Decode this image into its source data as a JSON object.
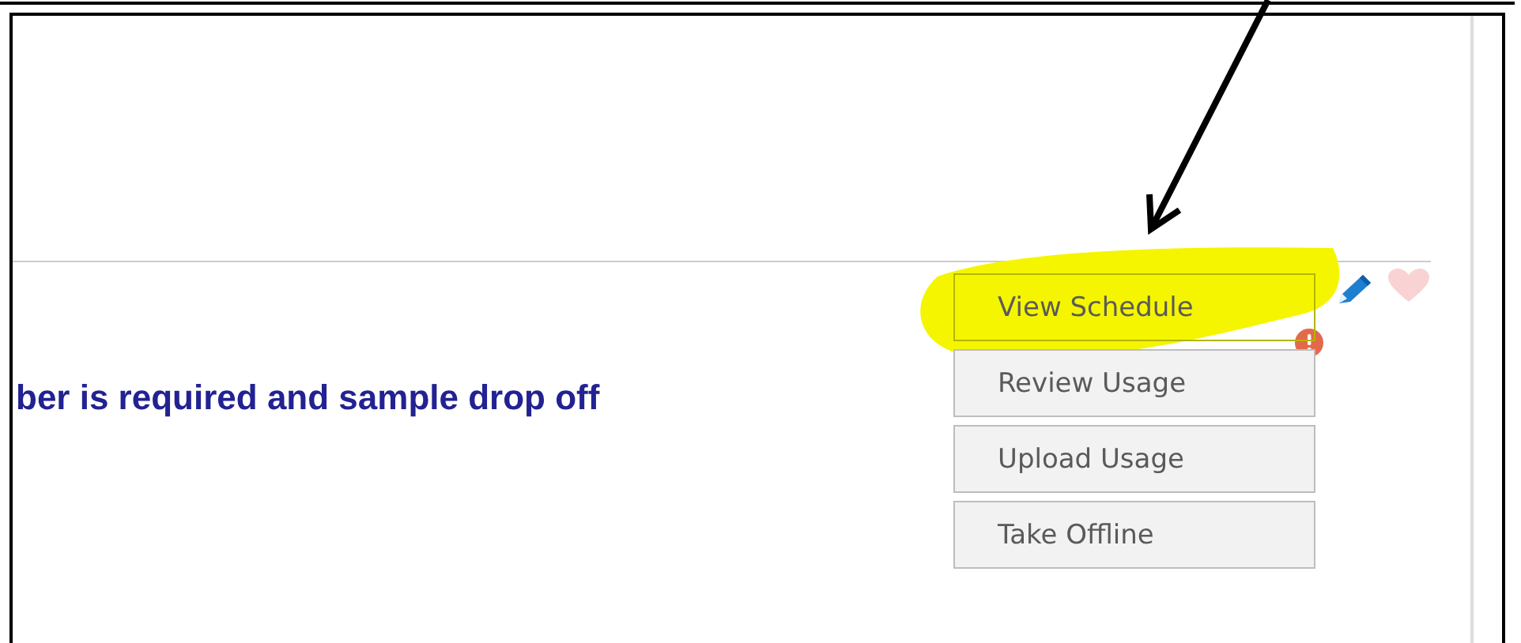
{
  "message": "ber is required and sample drop off",
  "actions": [
    {
      "label": "View Schedule",
      "highlighted": true,
      "alert": true
    },
    {
      "label": "Review Usage",
      "highlighted": false,
      "alert": false
    },
    {
      "label": "Upload Usage",
      "highlighted": false,
      "alert": false
    },
    {
      "label": "Take Offline",
      "highlighted": false,
      "alert": false
    }
  ]
}
